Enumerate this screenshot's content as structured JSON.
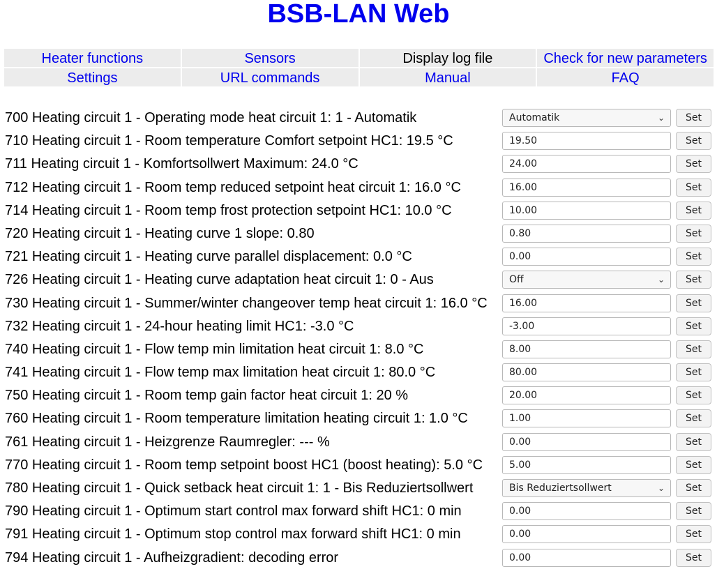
{
  "title": "BSB-LAN Web",
  "nav": [
    {
      "label": "Heater functions"
    },
    {
      "label": "Sensors"
    },
    {
      "label": "Display log file"
    },
    {
      "label": "Check for new parameters"
    },
    {
      "label": "Settings"
    },
    {
      "label": "URL commands"
    },
    {
      "label": "Manual"
    },
    {
      "label": "FAQ"
    }
  ],
  "set_label": "Set",
  "params": [
    {
      "label": "700 Heating circuit 1 - Operating mode heat circuit 1: 1 - Automatik",
      "value": "Automatik",
      "type": "select"
    },
    {
      "label": "710 Heating circuit 1 - Room temperature Comfort setpoint HC1: 19.5 °C",
      "value": "19.50",
      "type": "input"
    },
    {
      "label": "711 Heating circuit 1 - Komfortsollwert Maximum: 24.0 °C",
      "value": "24.00",
      "type": "input"
    },
    {
      "label": "712 Heating circuit 1 - Room temp reduced setpoint heat circuit 1: 16.0 °C",
      "value": "16.00",
      "type": "input"
    },
    {
      "label": "714 Heating circuit 1 - Room temp frost protection setpoint HC1: 10.0 °C",
      "value": "10.00",
      "type": "input"
    },
    {
      "label": "720 Heating circuit 1 - Heating curve 1 slope: 0.80",
      "value": "0.80",
      "type": "input"
    },
    {
      "label": "721 Heating circuit 1 - Heating curve parallel displacement: 0.0 °C",
      "value": "0.00",
      "type": "input"
    },
    {
      "label": "726 Heating circuit 1 - Heating curve adaptation heat circuit 1: 0 - Aus",
      "value": "Off",
      "type": "select"
    },
    {
      "label": "730 Heating circuit 1 - Summer/winter changeover temp heat circuit 1: 16.0 °C",
      "value": "16.00",
      "type": "input"
    },
    {
      "label": "732 Heating circuit 1 - 24-hour heating limit HC1: -3.0 °C",
      "value": "-3.00",
      "type": "input"
    },
    {
      "label": "740 Heating circuit 1 - Flow temp min limitation heat circuit 1: 8.0 °C",
      "value": "8.00",
      "type": "input"
    },
    {
      "label": "741 Heating circuit 1 - Flow temp max limitation heat circuit 1: 80.0 °C",
      "value": "80.00",
      "type": "input"
    },
    {
      "label": "750 Heating circuit 1 - Room temp gain factor heat circuit 1: 20 %",
      "value": "20.00",
      "type": "input"
    },
    {
      "label": "760 Heating circuit 1 - Room temperature limitation heating circuit 1: 1.0 °C",
      "value": "1.00",
      "type": "input"
    },
    {
      "label": "761 Heating circuit 1 - Heizgrenze Raumregler: --- %",
      "value": "0.00",
      "type": "input"
    },
    {
      "label": "770 Heating circuit 1 - Room temp setpoint boost HC1 (boost heating): 5.0 °C",
      "value": "5.00",
      "type": "input"
    },
    {
      "label": "780 Heating circuit 1 - Quick setback heat circuit 1: 1 - Bis Reduziertsollwert",
      "value": "Bis Reduziertsollwert",
      "type": "select"
    },
    {
      "label": "790 Heating circuit 1 - Optimum start control max forward shift HC1: 0 min",
      "value": "0.00",
      "type": "input"
    },
    {
      "label": "791 Heating circuit 1 - Optimum stop control max forward shift HC1: 0 min",
      "value": "0.00",
      "type": "input"
    },
    {
      "label": "794 Heating circuit 1 - Aufheizgradient: decoding error",
      "value": "0.00",
      "type": "input"
    }
  ]
}
